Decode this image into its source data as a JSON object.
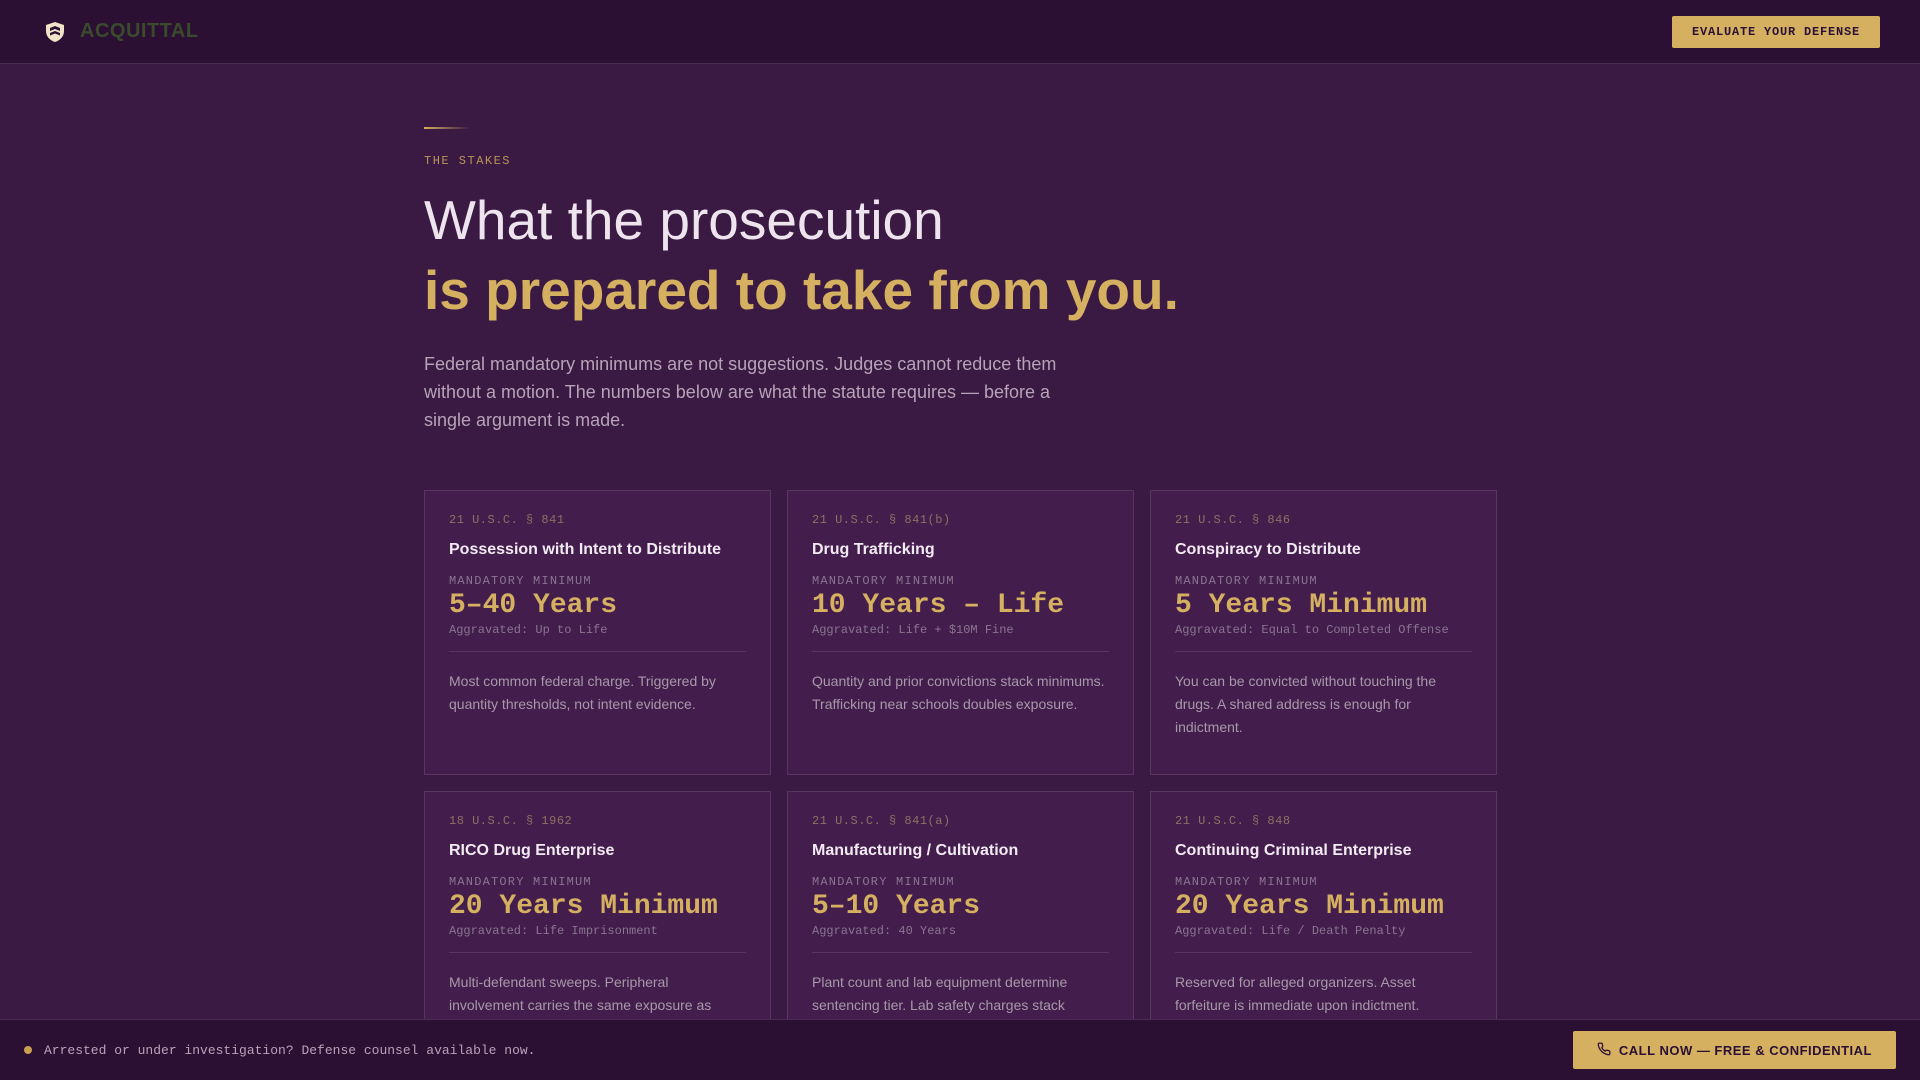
{
  "nav": {
    "brand": "ACQUITTAL",
    "brand_icon": "shield-icon",
    "cta": "EVALUATE YOUR DEFENSE"
  },
  "hero": {
    "eyebrow": "THE STAKES",
    "title_line1": "What the prosecution",
    "title_line2": "is prepared to take from you.",
    "lede": "Federal mandatory minimums are not suggestions. Judges cannot reduce them without a motion. The numbers below are what the statute requires — before a single argument is made."
  },
  "cards": [
    {
      "code": "21 U.S.C. § 841",
      "title": "Possession with Intent to Distribute",
      "min_label": "MANDATORY MINIMUM",
      "min_value": "5–40 Years",
      "aggravated": "Aggravated: Up to Life",
      "desc": "Most common federal charge. Triggered by quantity thresholds, not intent evidence."
    },
    {
      "code": "21 U.S.C. § 841(b)",
      "title": "Drug Trafficking",
      "min_label": "MANDATORY MINIMUM",
      "min_value": "10 Years – Life",
      "aggravated": "Aggravated: Life + $10M Fine",
      "desc": "Quantity and prior convictions stack minimums. Trafficking near schools doubles exposure."
    },
    {
      "code": "21 U.S.C. § 846",
      "title": "Conspiracy to Distribute",
      "min_label": "MANDATORY MINIMUM",
      "min_value": "5 Years Minimum",
      "aggravated": "Aggravated: Equal to Completed Offense",
      "desc": "You can be convicted without touching the drugs. A shared address is enough for indictment."
    },
    {
      "code": "18 U.S.C. § 1962",
      "title": "RICO Drug Enterprise",
      "min_label": "MANDATORY MINIMUM",
      "min_value": "20 Years Minimum",
      "aggravated": "Aggravated: Life Imprisonment",
      "desc": "Multi-defendant sweeps. Peripheral involvement carries the same exposure as"
    },
    {
      "code": "21 U.S.C. § 841(a)",
      "title": "Manufacturing / Cultivation",
      "min_label": "MANDATORY MINIMUM",
      "min_value": "5–10 Years",
      "aggravated": "Aggravated: 40 Years",
      "desc": "Plant count and lab equipment determine sentencing tier. Lab safety charges stack"
    },
    {
      "code": "21 U.S.C. § 848",
      "title": "Continuing Criminal Enterprise",
      "min_label": "MANDATORY MINIMUM",
      "min_value": "20 Years Minimum",
      "aggravated": "Aggravated: Life / Death Penalty",
      "desc": "Reserved for alleged organizers. Asset forfeiture is immediate upon indictment."
    }
  ],
  "bottom_bar": {
    "notice": "Arrested or under investigation? Defense counsel available now.",
    "call_cta": "CALL NOW — FREE & CONFIDENTIAL",
    "call_icon": "phone-icon"
  },
  "colors": {
    "background": "#3a1942",
    "nav_bg": "#2c1034",
    "accent_gold": "#d4b060",
    "card_bg": "#431d4c"
  }
}
